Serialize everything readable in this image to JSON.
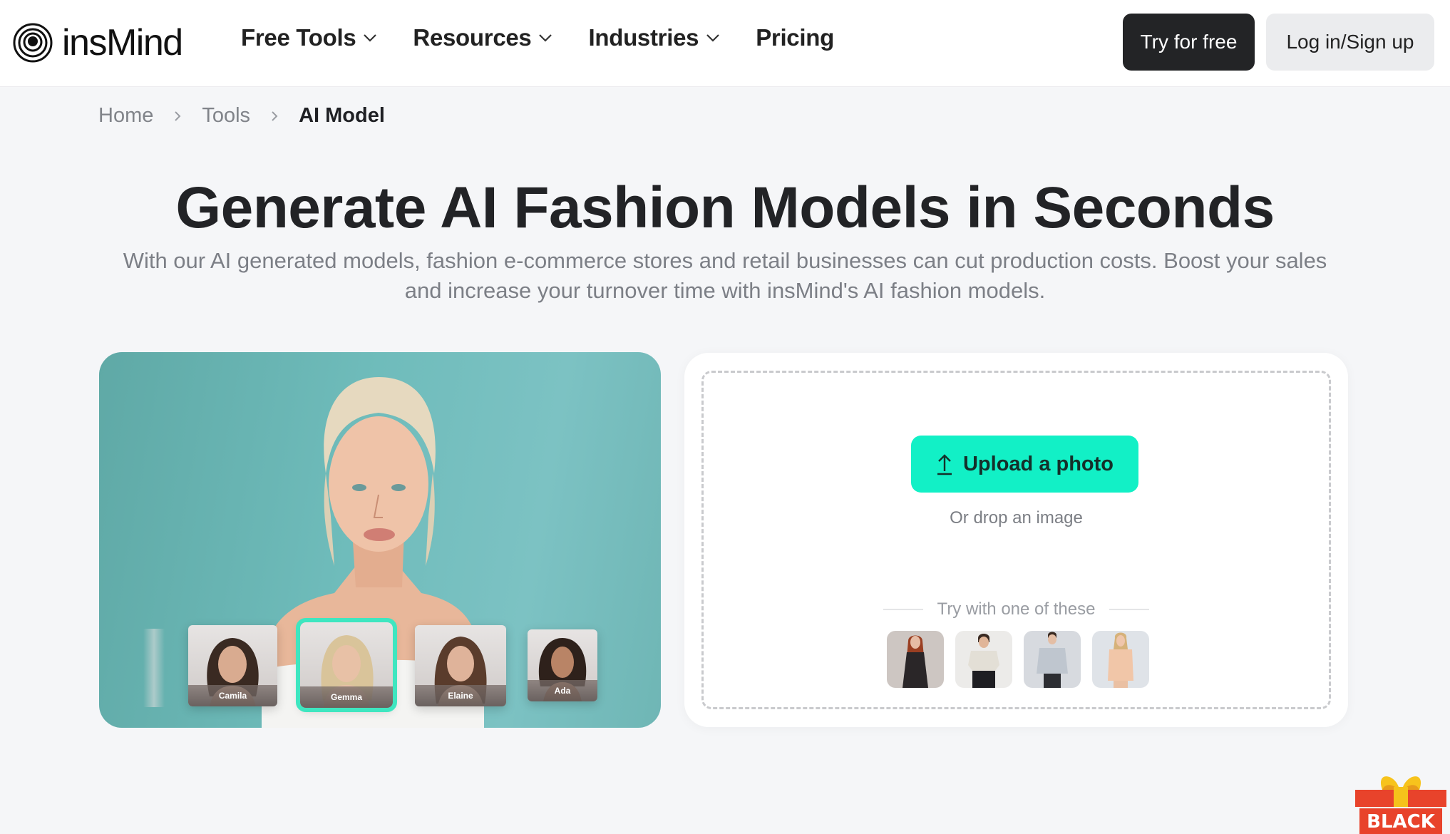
{
  "header": {
    "brand": "insMind",
    "nav": [
      {
        "label": "Free Tools",
        "has_dropdown": true
      },
      {
        "label": "Resources",
        "has_dropdown": true
      },
      {
        "label": "Industries",
        "has_dropdown": true
      },
      {
        "label": "Pricing",
        "has_dropdown": false
      }
    ],
    "try_button": "Try for free",
    "login_button": "Log in/Sign up"
  },
  "breadcrumb": [
    {
      "label": "Home"
    },
    {
      "label": "Tools"
    },
    {
      "label": "AI Model",
      "current": true
    }
  ],
  "hero": {
    "title": "Generate AI Fashion Models in Seconds",
    "subtitle": "With our AI generated models, fashion e-commerce stores and retail businesses can cut production costs. Boost your sales and increase your turnover time with insMind's AI fashion models."
  },
  "showcase": {
    "models": [
      {
        "name": "Camila",
        "selected": false
      },
      {
        "name": "Gemma",
        "selected": true
      },
      {
        "name": "Elaine",
        "selected": false
      },
      {
        "name": "Ada",
        "selected": false
      }
    ]
  },
  "upload": {
    "button_label": "Upload a photo",
    "drop_hint": "Or drop an image",
    "try_label": "Try with one of these",
    "samples": [
      {
        "name": "sample-red-hair-black-dress"
      },
      {
        "name": "sample-striped-tee"
      },
      {
        "name": "sample-grey-sweater"
      },
      {
        "name": "sample-peach-shirt"
      }
    ]
  },
  "promo": {
    "label": "BLACK"
  },
  "colors": {
    "accent": "#12f0c6",
    "selected_outline": "#3ee6c0",
    "primary_button": "#232426",
    "hero_bg": "#6fbcbb",
    "promo_red": "#e8432b",
    "promo_gold": "#f5c21b"
  }
}
